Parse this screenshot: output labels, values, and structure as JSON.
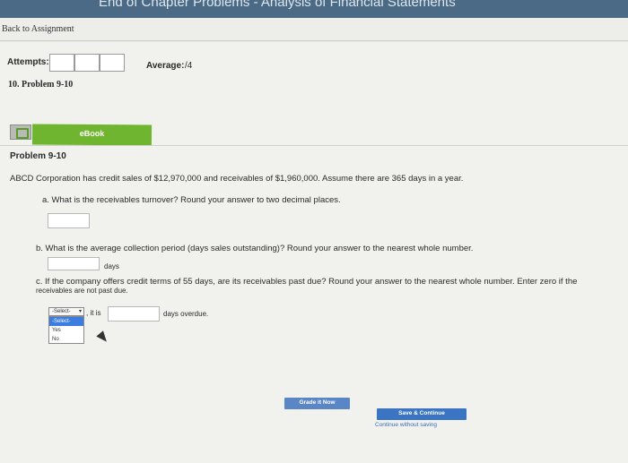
{
  "window": {
    "title": "End of Chapter Problems - Analysis of Financial Statements"
  },
  "nav": {
    "back_label": "Back to Assignment"
  },
  "header": {
    "attempts_label": "Attempts:",
    "attempt_boxes": 3,
    "average_label": "Average:",
    "average_value": "/4",
    "problem_number": "10. Problem 9-10"
  },
  "ebook": {
    "icon": "book-icon",
    "label": "eBook",
    "color": "#6fb52f"
  },
  "problem": {
    "title": "Problem 9-10",
    "statement": "ABCD Corporation has credit sales of $12,970,000 and receivables of $1,960,000. Assume there are 365 days in a year.",
    "part_a": {
      "question": "a. What is the receivables turnover? Round your answer to two decimal places.",
      "answer": ""
    },
    "part_b": {
      "question": "b. What is the average collection period (days sales outstanding)? Round your answer to the nearest whole number.",
      "unit": "days",
      "answer": ""
    },
    "part_c": {
      "question_line1": "c. If the company offers credit terms of 55 days, are its receivables past due? Round your answer to the nearest whole number. Enter zero if the",
      "question_line2": "receivables are not past due.",
      "select_value": "-Select-",
      "options": [
        "-Select-",
        "Yes",
        "No"
      ],
      "it_is": ", it is",
      "answer": "",
      "suffix": "days overdue."
    }
  },
  "actions": {
    "grade_label": "Grade it Now",
    "save_label": "Save & Continue",
    "continue_label": "Continue without saving",
    "accent": "#3a74c2"
  }
}
